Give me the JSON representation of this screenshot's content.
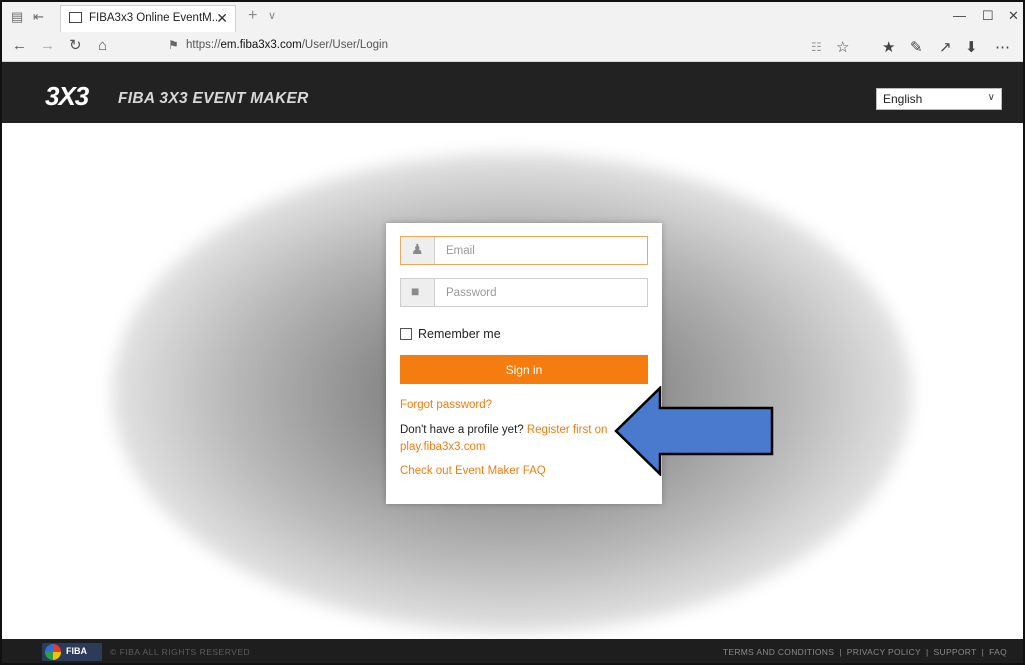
{
  "browser": {
    "tab_title": "FIBA3x3 Online EventM...",
    "tab_close": "✕",
    "new_tab": "+",
    "tab_list": "∨",
    "minimize": "—",
    "maximize": "☐",
    "close": "✕",
    "url_prefix": "https://",
    "url_host": "em.fiba3x3.com",
    "url_path": "/User/User/Login"
  },
  "header": {
    "logo": "3X3",
    "title": "FIBA 3X3 EVENT MAKER",
    "language_selected": "English"
  },
  "login": {
    "email_placeholder": "Email",
    "password_placeholder": "Password",
    "remember_label": "Remember me",
    "signin_label": "Sign in",
    "forgot_label": "Forgot password?",
    "register_text": "Don't have a profile yet? ",
    "register_link": "Register first on play.fiba3x3.com",
    "faq_label": "Check out Event Maker FAQ"
  },
  "footer": {
    "badge": "FIBA",
    "copyright": "© FIBA ALL RIGHTS RESERVED",
    "links": [
      "TERMS AND CONDITIONS",
      "PRIVACY POLICY",
      "SUPPORT",
      "FAQ"
    ]
  },
  "colors": {
    "accent": "#f57c0f",
    "header_bg": "#222222",
    "footer_bg": "#1e1e1e",
    "arrow": "#4a7acd"
  },
  "icons": {
    "email": "user-icon",
    "password": "lock-icon"
  }
}
